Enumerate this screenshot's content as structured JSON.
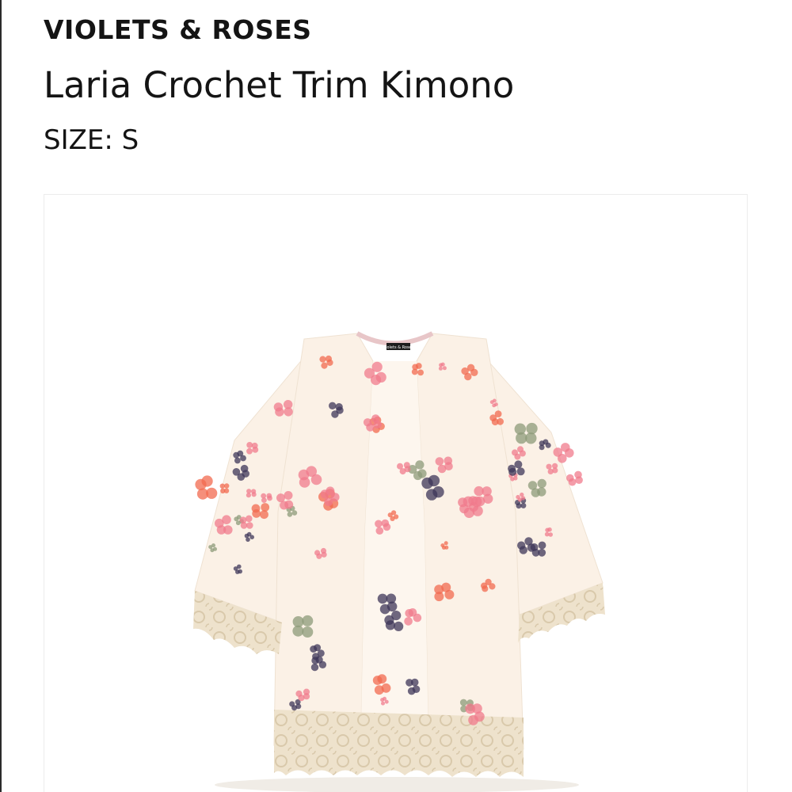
{
  "product": {
    "brand": "VIOLETS & ROSES",
    "name": "Laria Crochet Trim Kimono",
    "size_text": "SIZE: S",
    "image": {
      "description_icon": "kimono-image",
      "neck_tag_text": "Violets & Roses"
    }
  },
  "colors": {
    "fabric": "#fbf1e6",
    "lace": "#eee2cc",
    "flower_pink": "#f07b8c",
    "flower_coral": "#f26a4f",
    "flower_navy": "#3d3558",
    "leaf": "#8c9a78"
  }
}
